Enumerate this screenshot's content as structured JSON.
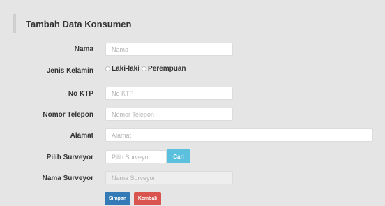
{
  "form": {
    "title": "Tambah Data Konsumen",
    "fields": {
      "nama": {
        "label": "Nama",
        "placeholder": "Nama"
      },
      "jenis_kelamin": {
        "label": "Jenis Kelamin",
        "options": [
          "Laki-laki",
          "Perempuan"
        ]
      },
      "no_ktp": {
        "label": "No KTP",
        "placeholder": "No KTP"
      },
      "nomor_telepon": {
        "label": "Nomor Telepon",
        "placeholder": "Nomor Telepon"
      },
      "alamat": {
        "label": "Alamat",
        "placeholder": "Alamat"
      },
      "pilih_surveyor": {
        "label": "Pilih Surveyor",
        "placeholder": "Pilih Surveyor",
        "button": "Cari"
      },
      "nama_surveyor": {
        "label": "Nama Surveyor",
        "placeholder": "Nama Surveyor"
      }
    },
    "actions": {
      "save": "Simpan",
      "back": "Kembali"
    }
  },
  "colors": {
    "background": "#e5e5e5",
    "primary": "#337ab7",
    "info": "#5bc0de",
    "danger": "#d9534f"
  }
}
